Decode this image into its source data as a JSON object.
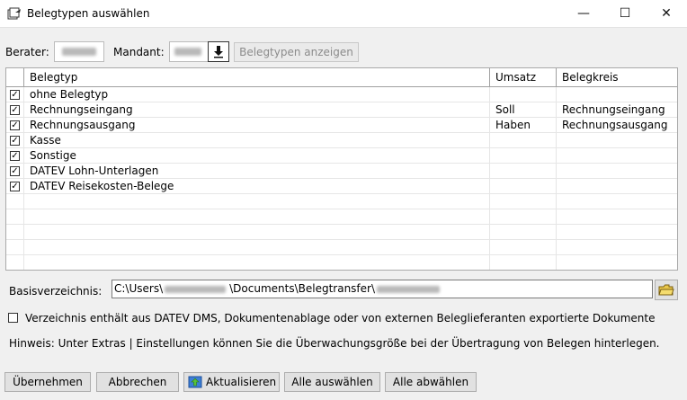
{
  "window": {
    "title": "Belegtypen auswählen",
    "minimize": "—",
    "maximize": "☐",
    "close": "✕"
  },
  "filters": {
    "berater_label": "Berater:",
    "mandant_label": "Mandant:",
    "show_button": "Belegtypen anzeigen"
  },
  "grid": {
    "columns": [
      "Belegtyp",
      "Umsatz",
      "Belegkreis"
    ],
    "rows": [
      {
        "checked": true,
        "belegtyp": "ohne Belegtyp",
        "umsatz": "",
        "belegkreis": ""
      },
      {
        "checked": true,
        "belegtyp": "Rechnungseingang",
        "umsatz": "Soll",
        "belegkreis": "Rechnungseingang"
      },
      {
        "checked": true,
        "belegtyp": "Rechnungsausgang",
        "umsatz": "Haben",
        "belegkreis": "Rechnungsausgang"
      },
      {
        "checked": true,
        "belegtyp": "Kasse",
        "umsatz": "",
        "belegkreis": ""
      },
      {
        "checked": true,
        "belegtyp": "Sonstige",
        "umsatz": "",
        "belegkreis": ""
      },
      {
        "checked": true,
        "belegtyp": "DATEV Lohn-Unterlagen",
        "umsatz": "",
        "belegkreis": ""
      },
      {
        "checked": true,
        "belegtyp": "DATEV Reisekosten-Belege",
        "umsatz": "",
        "belegkreis": ""
      }
    ]
  },
  "basis": {
    "label": "Basisverzeichnis:",
    "path_prefix": "C:\\Users\\",
    "path_middle": "\\Documents\\Belegtransfer\\"
  },
  "option_checkbox": {
    "checked": false,
    "label": "Verzeichnis enthält aus DATEV DMS, Dokumentenablage oder von externen Beleglieferanten exportierte Dokumente"
  },
  "hint": "Hinweis: Unter Extras | Einstellungen können Sie die Überwachungsgröße bei der Übertragung von Belegen hinterlegen.",
  "buttons": {
    "apply": "Übernehmen",
    "cancel": "Abbrechen",
    "refresh": "Aktualisieren",
    "select_all": "Alle auswählen",
    "deselect_all": "Alle abwählen"
  }
}
